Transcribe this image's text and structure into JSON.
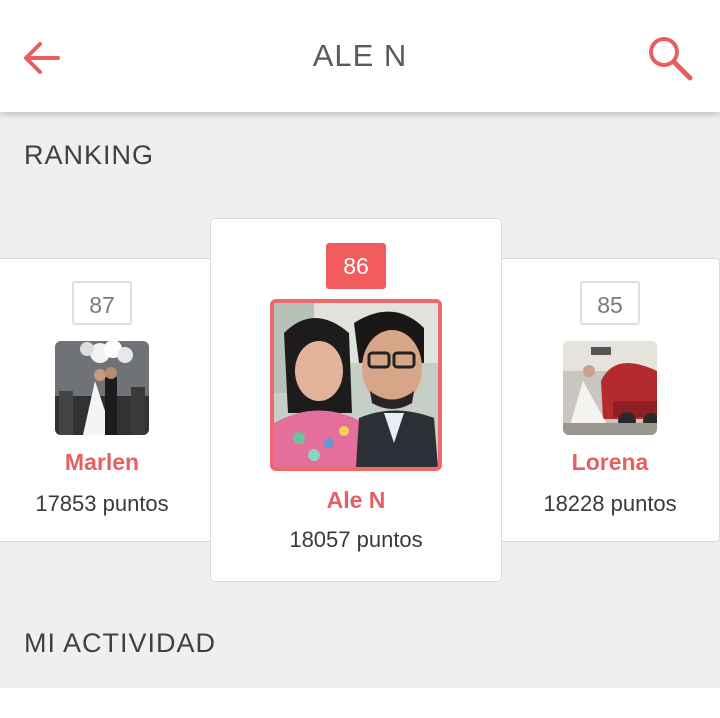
{
  "header": {
    "title": "ALE N",
    "back_icon": "arrow-left-icon",
    "search_icon": "search-icon",
    "accent": "#e85f62"
  },
  "ranking": {
    "section_title": "RANKING",
    "entries": [
      {
        "rank": "87",
        "name": "Marlen",
        "points": "17853 puntos"
      },
      {
        "rank": "86",
        "name": "Ale N",
        "points": "18057 puntos",
        "current": true
      },
      {
        "rank": "85",
        "name": "Lorena",
        "points": "18228 puntos"
      }
    ]
  },
  "activity": {
    "section_title": "MI ACTIVIDAD"
  }
}
